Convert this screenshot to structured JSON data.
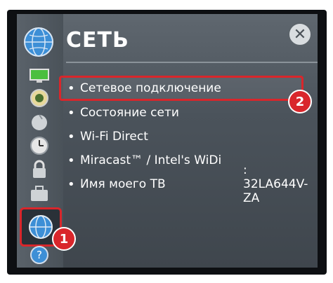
{
  "header": {
    "title": "СЕТЬ",
    "close_label": "✕"
  },
  "menu": {
    "items": [
      {
        "label": "Сетевое подключение",
        "value": ""
      },
      {
        "label": "Состояние сети",
        "value": ""
      },
      {
        "label": "Wi-Fi Direct",
        "value": ""
      },
      {
        "label": "Miracast™ / Intel's WiDi",
        "value": ""
      },
      {
        "label": "Имя моего ТВ",
        "value": ":   32LA644V-ZA"
      }
    ]
  },
  "sidebar": {
    "icons": [
      "picture-icon",
      "audio-icon",
      "channel-icon",
      "time-icon",
      "lock-icon",
      "option-icon",
      "network-globe-icon",
      "support-icon"
    ]
  },
  "badges": {
    "sidebar_step": "1",
    "menu_step": "2"
  },
  "colors": {
    "highlight": "#d9262b"
  }
}
